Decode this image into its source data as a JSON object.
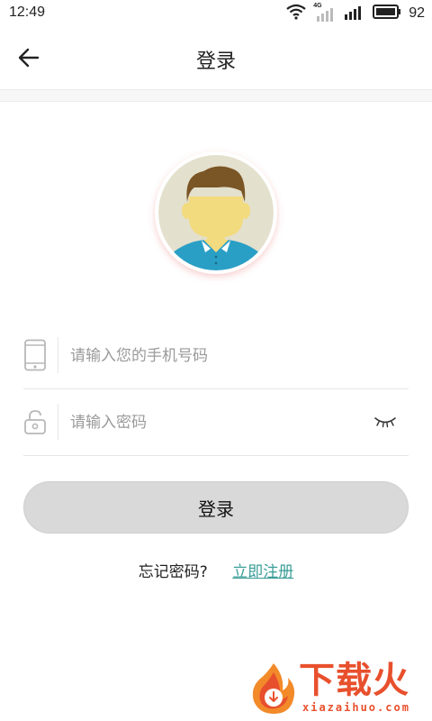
{
  "status_bar": {
    "time": "12:49",
    "network_label": "4G",
    "battery": "92",
    "icons": [
      "wifi-icon",
      "signal-4g-icon",
      "signal-icon",
      "battery-icon"
    ]
  },
  "header": {
    "title": "登录",
    "back_icon": "arrow-left-icon"
  },
  "avatar": {
    "icon": "default-user-avatar"
  },
  "form": {
    "phone": {
      "icon": "phone-icon",
      "placeholder": "请输入您的手机号码",
      "value": ""
    },
    "password": {
      "icon": "lock-icon",
      "placeholder": "请输入密码",
      "value": "",
      "toggle_icon": "eye-closed-icon"
    }
  },
  "login_button": {
    "label": "登录"
  },
  "links": {
    "forgot_password": "忘记密码?",
    "register": "立即注册"
  },
  "watermark": {
    "title": "下载火",
    "url": "xiazaihuo.com"
  },
  "colors": {
    "accent_link": "#3a9d97",
    "button_bg": "#d9d9d9",
    "watermark": "#e8502d"
  }
}
